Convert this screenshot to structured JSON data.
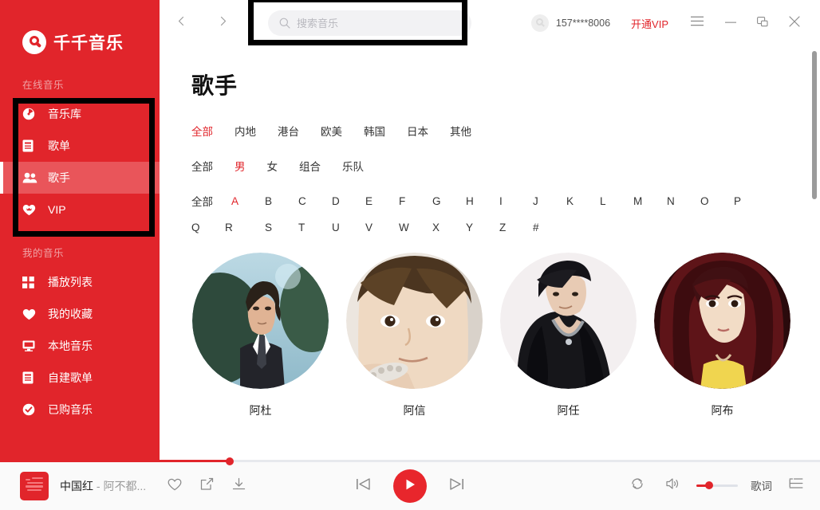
{
  "brand": {
    "name": "千千音乐",
    "logo_icon": "qianqian-logo-icon"
  },
  "sidebar": {
    "sections": [
      {
        "label": "在线音乐",
        "items": [
          {
            "label": "音乐库",
            "icon": "disc-icon",
            "active": false
          },
          {
            "label": "歌单",
            "icon": "list-card-icon",
            "active": false
          },
          {
            "label": "歌手",
            "icon": "users-icon",
            "active": true
          },
          {
            "label": "VIP",
            "icon": "heart-crown-icon",
            "active": false
          }
        ]
      },
      {
        "label": "我的音乐",
        "items": [
          {
            "label": "播放列表",
            "icon": "grid-icon",
            "active": false
          },
          {
            "label": "我的收藏",
            "icon": "heart-icon",
            "active": false
          },
          {
            "label": "本地音乐",
            "icon": "monitor-icon",
            "active": false
          },
          {
            "label": "自建歌单",
            "icon": "list-card-icon",
            "active": false
          },
          {
            "label": "已购音乐",
            "icon": "check-circle-icon",
            "active": false
          }
        ]
      }
    ]
  },
  "topbar": {
    "back_icon": "chevron-left-icon",
    "forward_icon": "chevron-right-icon",
    "search": {
      "placeholder": "搜索音乐",
      "value": "",
      "icon": "search-icon"
    },
    "account": {
      "avatar_icon": "user-avatar-icon",
      "phone": "157****8006"
    },
    "vip_label": "开通VIP",
    "menu_icon": "hamburger-menu-icon",
    "minimize_icon": "minimize-icon",
    "restore_icon": "restore-window-icon",
    "close_icon": "close-icon"
  },
  "main": {
    "title": "歌手",
    "filters": {
      "region": {
        "items": [
          "全部",
          "内地",
          "港台",
          "欧美",
          "韩国",
          "日本",
          "其他"
        ],
        "selected": "全部"
      },
      "gender": {
        "items": [
          "全部",
          "男",
          "女",
          "组合",
          "乐队"
        ],
        "selected": "男"
      },
      "letter": {
        "items": [
          "全部",
          "A",
          "B",
          "C",
          "D",
          "E",
          "F",
          "G",
          "H",
          "I",
          "J",
          "K",
          "L",
          "M",
          "N",
          "O",
          "P",
          "Q",
          "R",
          "S",
          "T",
          "U",
          "V",
          "W",
          "X",
          "Y",
          "Z",
          "#"
        ],
        "selected": "A"
      }
    },
    "artists": [
      {
        "name": "阿杜"
      },
      {
        "name": "阿信"
      },
      {
        "name": "阿任"
      },
      {
        "name": "阿布"
      }
    ]
  },
  "player": {
    "progress_percent": 28,
    "song": {
      "title": "中国红",
      "separator": " - ",
      "artist": "阿不都..."
    },
    "actions": {
      "favorite_icon": "heart-outline-icon",
      "share_icon": "share-icon",
      "download_icon": "download-icon"
    },
    "controls": {
      "prev_icon": "previous-track-icon",
      "play_icon": "play-icon",
      "next_icon": "next-track-icon"
    },
    "right": {
      "repeat_icon": "repeat-icon",
      "volume_icon": "volume-icon",
      "volume_percent": 30,
      "lyrics_label": "歌词",
      "playlist_icon": "playlist-icon"
    }
  },
  "colors": {
    "brand_red": "#e1252b",
    "sidebar_active": "#e9555a",
    "accent_text": "#e1252b",
    "play_button": "#e8262c",
    "annotation_box": "#000000"
  },
  "scrollbar": {
    "thumb_color": "#9b9b9b"
  }
}
